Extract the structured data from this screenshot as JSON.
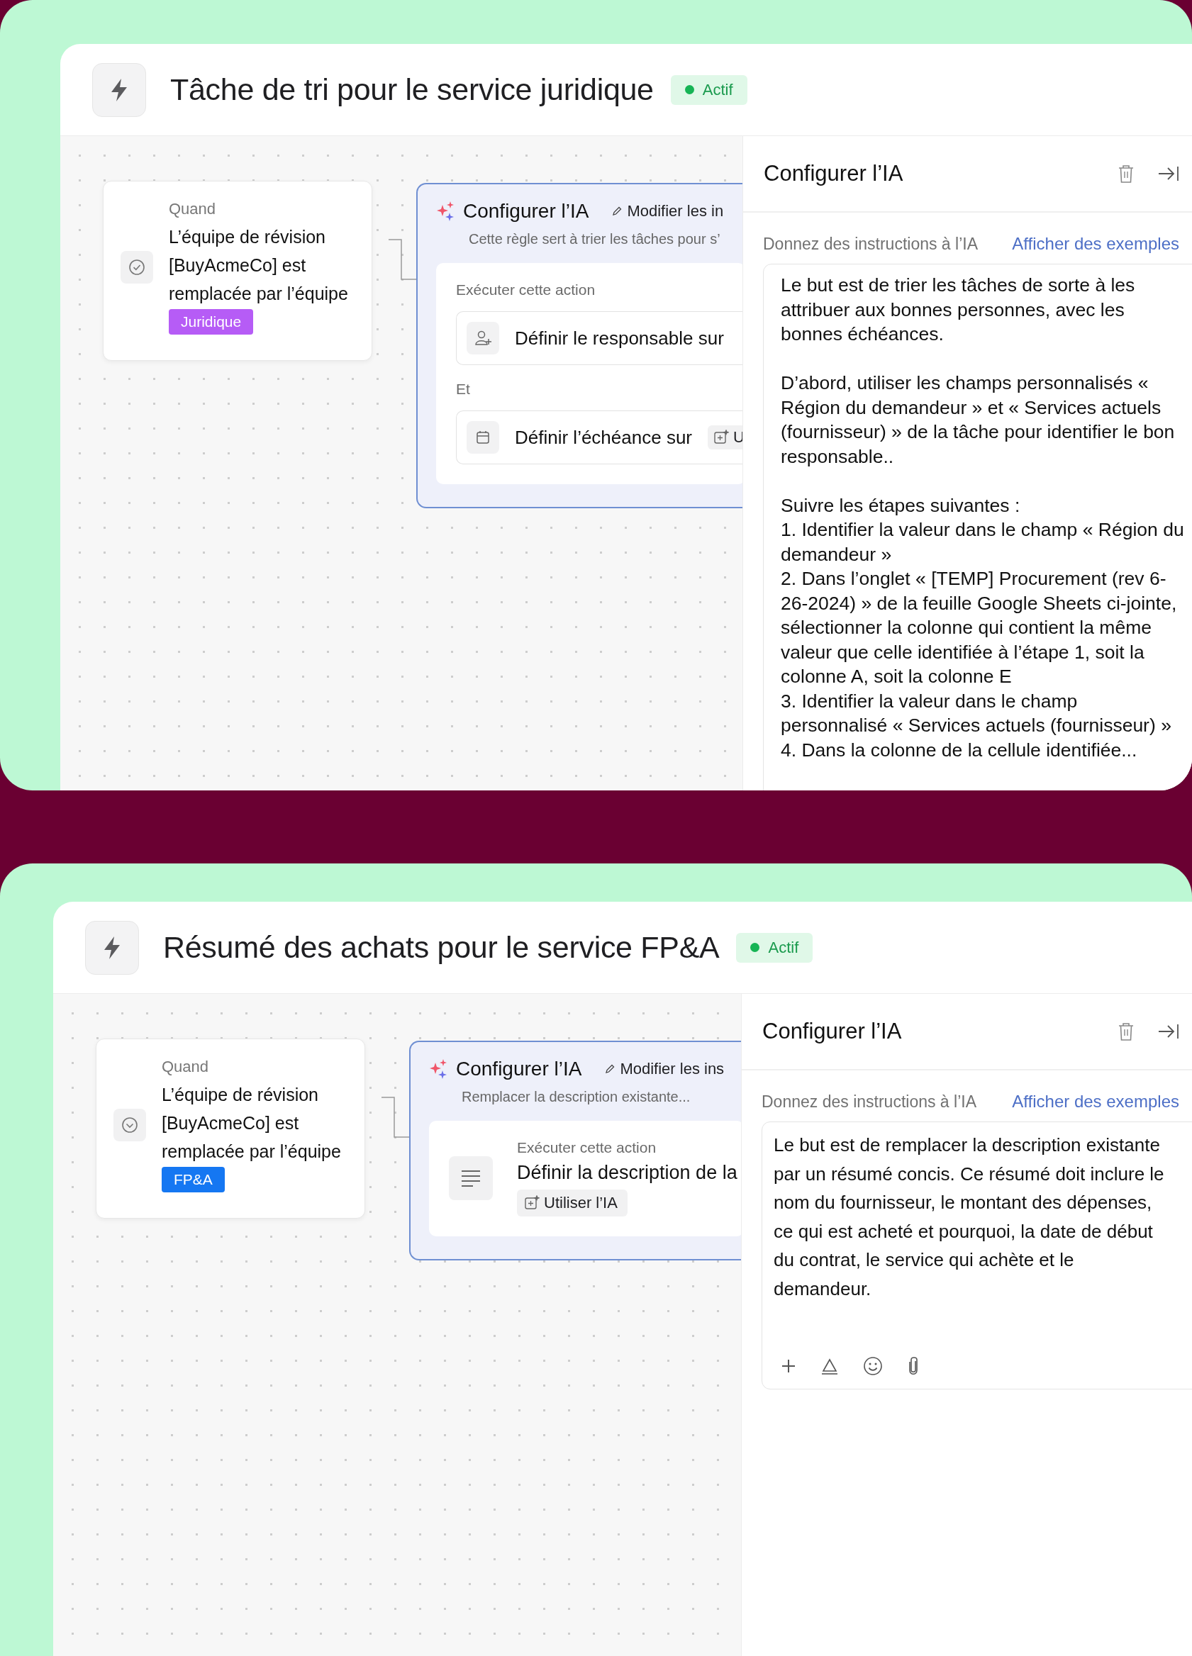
{
  "panels": [
    {
      "title": "Tâche de tri pour le service juridique",
      "status": "Actif",
      "trigger": {
        "label": "Quand",
        "text": "L’équipe de révision [BuyAcmeCo] est remplacée par l’équipe",
        "tag": {
          "label": "Juridique",
          "color": "#b65cf6"
        }
      },
      "ai_node": {
        "title": "Configurer l’IA",
        "edit_link": "Modifier les in",
        "subtitle": "Cette règle sert à trier les tâches pour s’",
        "action": {
          "kind": "rows",
          "label": "Exécuter cette action",
          "items": [
            {
              "kind": "assignee",
              "text": "Définir le responsable sur"
            },
            {
              "kind": "conjunction",
              "text": "Et"
            },
            {
              "kind": "due-date",
              "text": "Définir l’échéance sur",
              "chip": "U"
            }
          ]
        }
      },
      "side_panel": {
        "title": "Configurer l’IA",
        "label": "Donnez des instructions à l’IA",
        "link": "Afficher des exemples",
        "instructions": "Le but est de trier les tâches de sorte à les attribuer aux bonnes personnes, avec les bonnes échéances.\n\nD’abord, utiliser les champs personnalisés « Région du demandeur » et « Services actuels (fournisseur) » de la tâche pour identifier le bon responsable..\n\nSuivre les étapes suivantes :\n1. Identifier la valeur dans le champ « Région du demandeur »\n2. Dans l’onglet « [TEMP] Procurement (rev 6-26-2024) » de la feuille Google Sheets ci-jointe, sélectionner la colonne qui contient la même valeur que celle identifiée à l’étape 1, soit la colonne A, soit la colonne E\n3. Identifier la valeur dans le champ personnalisé « Services actuels (fournisseur) »\n4. Dans la colonne de la cellule identifiée...",
        "toolbar": false
      }
    },
    {
      "title": "Résumé des achats pour le service FP&A",
      "status": "Actif",
      "trigger": {
        "label": "Quand",
        "text": "L’équipe de révision [BuyAcmeCo] est remplacée par l’équipe",
        "tag": {
          "label": "FP&A",
          "color": "#1577f2"
        }
      },
      "ai_node": {
        "title": "Configurer l’IA",
        "edit_link": "Modifier les ins",
        "subtitle": "Remplacer la description existante...",
        "action": {
          "kind": "stacked",
          "label": "Exécuter cette action",
          "text": "Définir la description de la",
          "chip": "Utiliser l’IA"
        }
      },
      "side_panel": {
        "title": "Configurer l’IA",
        "label": "Donnez des instructions à l’IA",
        "link": "Afficher des exemples",
        "instructions": "Le but est de remplacer la description existante par un résumé concis. Ce résumé doit inclure le nom du fournisseur, le montant des dépenses, ce qui est acheté et pourquoi, la date de début du contrat, le service qui achète et le demandeur.",
        "toolbar": true
      }
    }
  ]
}
